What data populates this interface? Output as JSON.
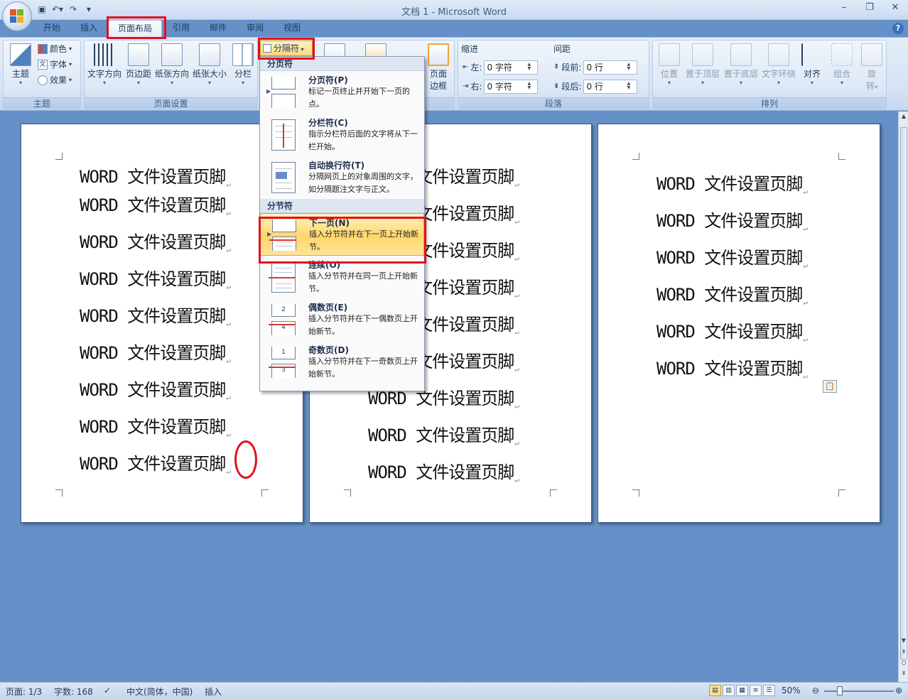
{
  "window": {
    "title": "文档 1 - Microsoft Word",
    "qat_icons": [
      "save-icon",
      "undo-icon",
      "redo-icon",
      "customize-icon"
    ]
  },
  "tabs": [
    "开始",
    "插入",
    "页面布局",
    "引用",
    "邮件",
    "审阅",
    "视图"
  ],
  "active_tab": "页面布局",
  "ribbon": {
    "theme_group": {
      "label": "主题",
      "theme_button": "主题",
      "colors": "颜色",
      "fonts": "字体",
      "effects": "效果"
    },
    "page_setup_group": {
      "label": "页面设置",
      "text_direction": "文字方向",
      "margins": "页边距",
      "orientation": "纸张方向",
      "size": "纸张大小",
      "columns": "分栏",
      "breaks": "分隔符"
    },
    "page_bg_group": {
      "page_borders": "页面\n边框",
      "page_borders_l1": "页面",
      "page_borders_l2": "边框"
    },
    "paragraph_group": {
      "label": "段落",
      "indent_title": "缩进",
      "spacing_title": "间距",
      "left_label": "左:",
      "left_value": "0 字符",
      "right_label": "右:",
      "right_value": "0 字符",
      "before_label": "段前:",
      "before_value": "0 行",
      "after_label": "段后:",
      "after_value": "0 行"
    },
    "arrange_group": {
      "label": "排列",
      "position": "位置",
      "bring_front": "置于顶层",
      "send_back": "置于底层",
      "wrap": "文字环绕",
      "align": "对齐",
      "group": "组合",
      "rotate_l1": "旋",
      "rotate_l2": "转"
    }
  },
  "menu": {
    "page_breaks_header": "分页符",
    "section_breaks_header": "分节符",
    "items": [
      {
        "title": "分页符(P)",
        "desc": "标记一页终止并开始下一页的点。"
      },
      {
        "title": "分栏符(C)",
        "desc": "指示分栏符后面的文字将从下一栏开始。"
      },
      {
        "title": "自动换行符(T)",
        "desc": "分隔网页上的对象周围的文字，如分隔题注文字与正文。"
      },
      {
        "title": "下一页(N)",
        "desc": "插入分节符并在下一页上开始新节。"
      },
      {
        "title": "连续(O)",
        "desc": "插入分节符并在同一页上开始新节。"
      },
      {
        "title": "偶数页(E)",
        "desc": "插入分节符并在下一偶数页上开始新节。"
      },
      {
        "title": "奇数页(D)",
        "desc": "插入分节符并在下一奇数页上开始新节。"
      }
    ]
  },
  "document": {
    "line_text": "WORD 文件设置页脚",
    "paragraph_mark": "↵",
    "page1_lines": 9,
    "page2_lines": 9,
    "page3_lines": 6
  },
  "status": {
    "page": "页面: 1/3",
    "words": "字数: 168",
    "language": "中文(简体，中国)",
    "mode": "插入",
    "zoom": "50%"
  },
  "colors": {
    "highlight_red": "#e3101e",
    "doc_background": "#6591c8",
    "menu_highlight": "#ffd66b"
  }
}
